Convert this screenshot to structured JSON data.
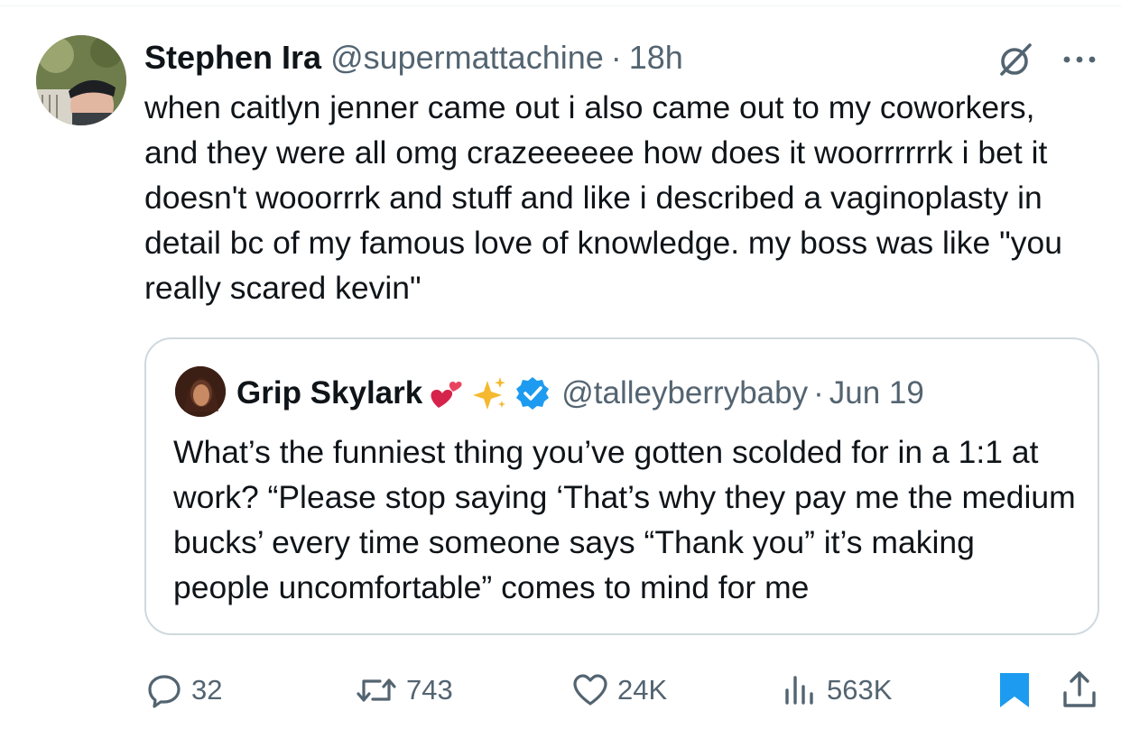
{
  "tweet": {
    "author_name": "Stephen Ira",
    "handle": "@supermattachine",
    "separator": "·",
    "time": "18h",
    "text": "when caitlyn jenner came out i also came out to my coworkers, and they were all omg crazeeeeee how does it woorrrrrrk i bet it doesn't wooorrrk and stuff and like i described a vaginoplasty in detail bc of my famous love of knowledge. my boss was like \"you really scared kevin\"",
    "header_icons": [
      "grok-icon",
      "more-icon"
    ]
  },
  "quote": {
    "author_name": "Grip Skylark",
    "emojis": [
      "two-hearts-icon",
      "sparkles-icon",
      "verified-badge-icon"
    ],
    "handle": "@talleyberrybaby",
    "separator": "·",
    "date": "Jun 19",
    "text": "What’s the funniest thing you’ve gotten scolded for in a 1:1 at work? “Please stop saying ‘That’s why they pay me the medium bucks’ every time someone says “Thank you” it’s making people uncomfortable” comes to mind for me"
  },
  "actions": {
    "replies": "32",
    "reposts": "743",
    "likes": "24K",
    "views": "563K"
  },
  "colors": {
    "text": "#0f1419",
    "secondary": "#536471",
    "accent": "#1d9bf0",
    "border": "#cfd9de",
    "heart_emoji": "#d5234b",
    "sparkle_emoji": "#f5b82e"
  }
}
